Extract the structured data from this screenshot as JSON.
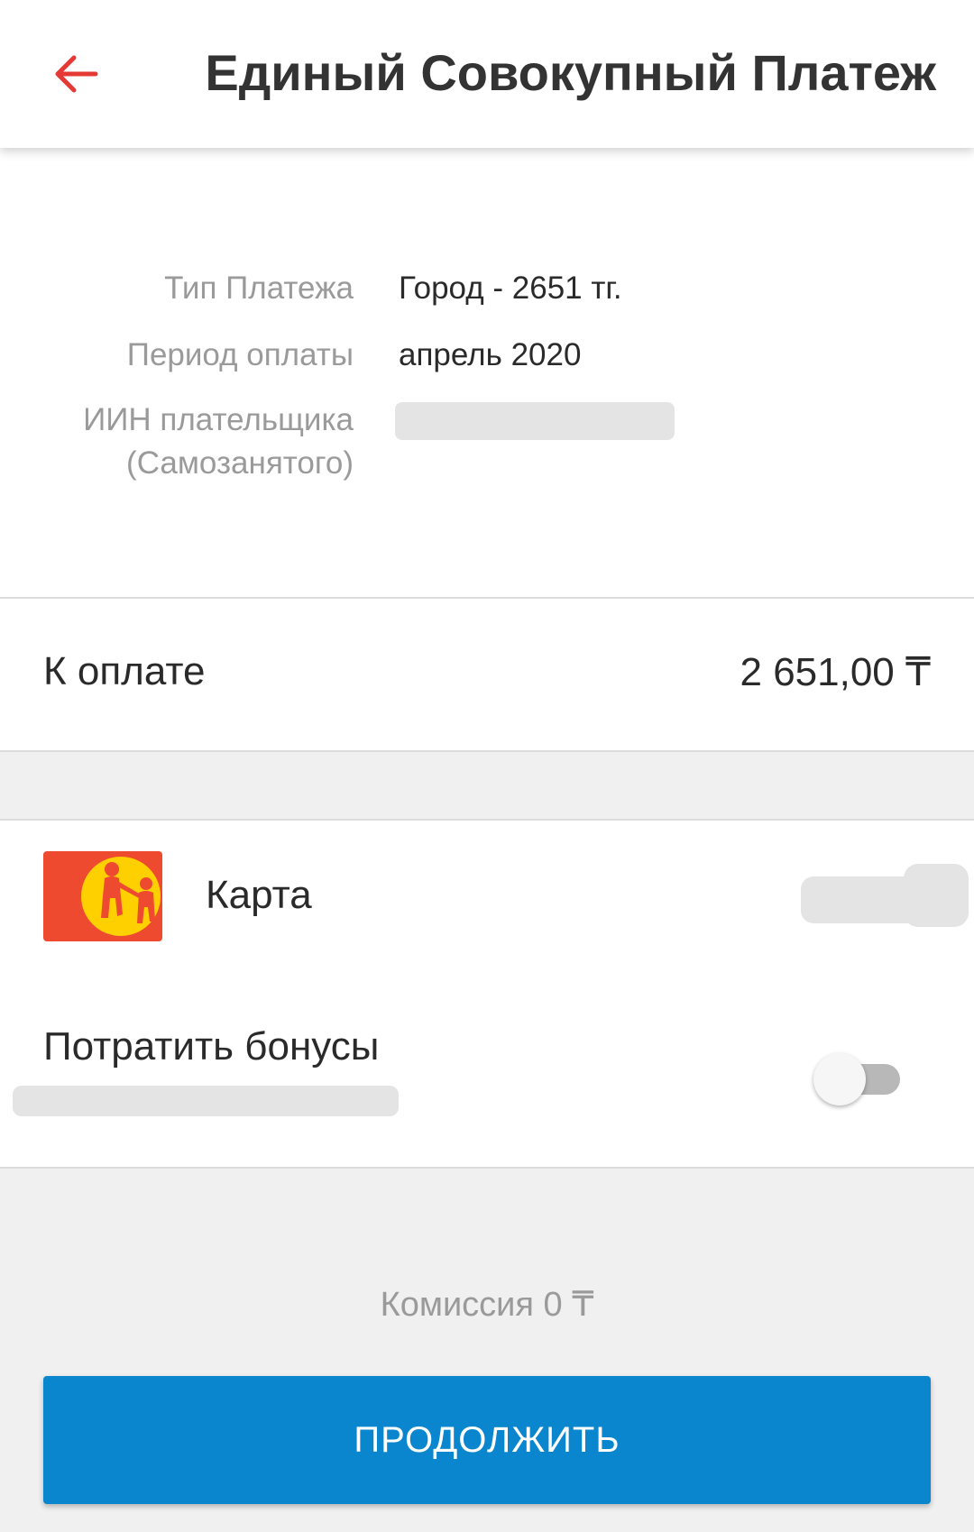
{
  "header": {
    "title": "Единый Совокупный Платеж",
    "back_icon": "arrow-left-icon",
    "accent_color": "#e53935"
  },
  "info": {
    "rows": [
      {
        "label": "Тип Платежа",
        "value": "Город - 2651 тг."
      },
      {
        "label": "Период оплаты",
        "value": "апрель 2020"
      },
      {
        "label": "ИИН плательщика\n(Самозанятого)",
        "value": ""
      }
    ]
  },
  "amount": {
    "label": "К оплате",
    "value": "2 651,00 ₸"
  },
  "payment_method": {
    "label": "Карта",
    "logo_icon": "card-logo-icon"
  },
  "bonus": {
    "label": "Потратить бонусы",
    "toggle_on": false
  },
  "commission": "Комиссия 0 ₸",
  "continue_button": {
    "label": "ПРОДОЛЖИТЬ",
    "color": "#0a86cf"
  }
}
